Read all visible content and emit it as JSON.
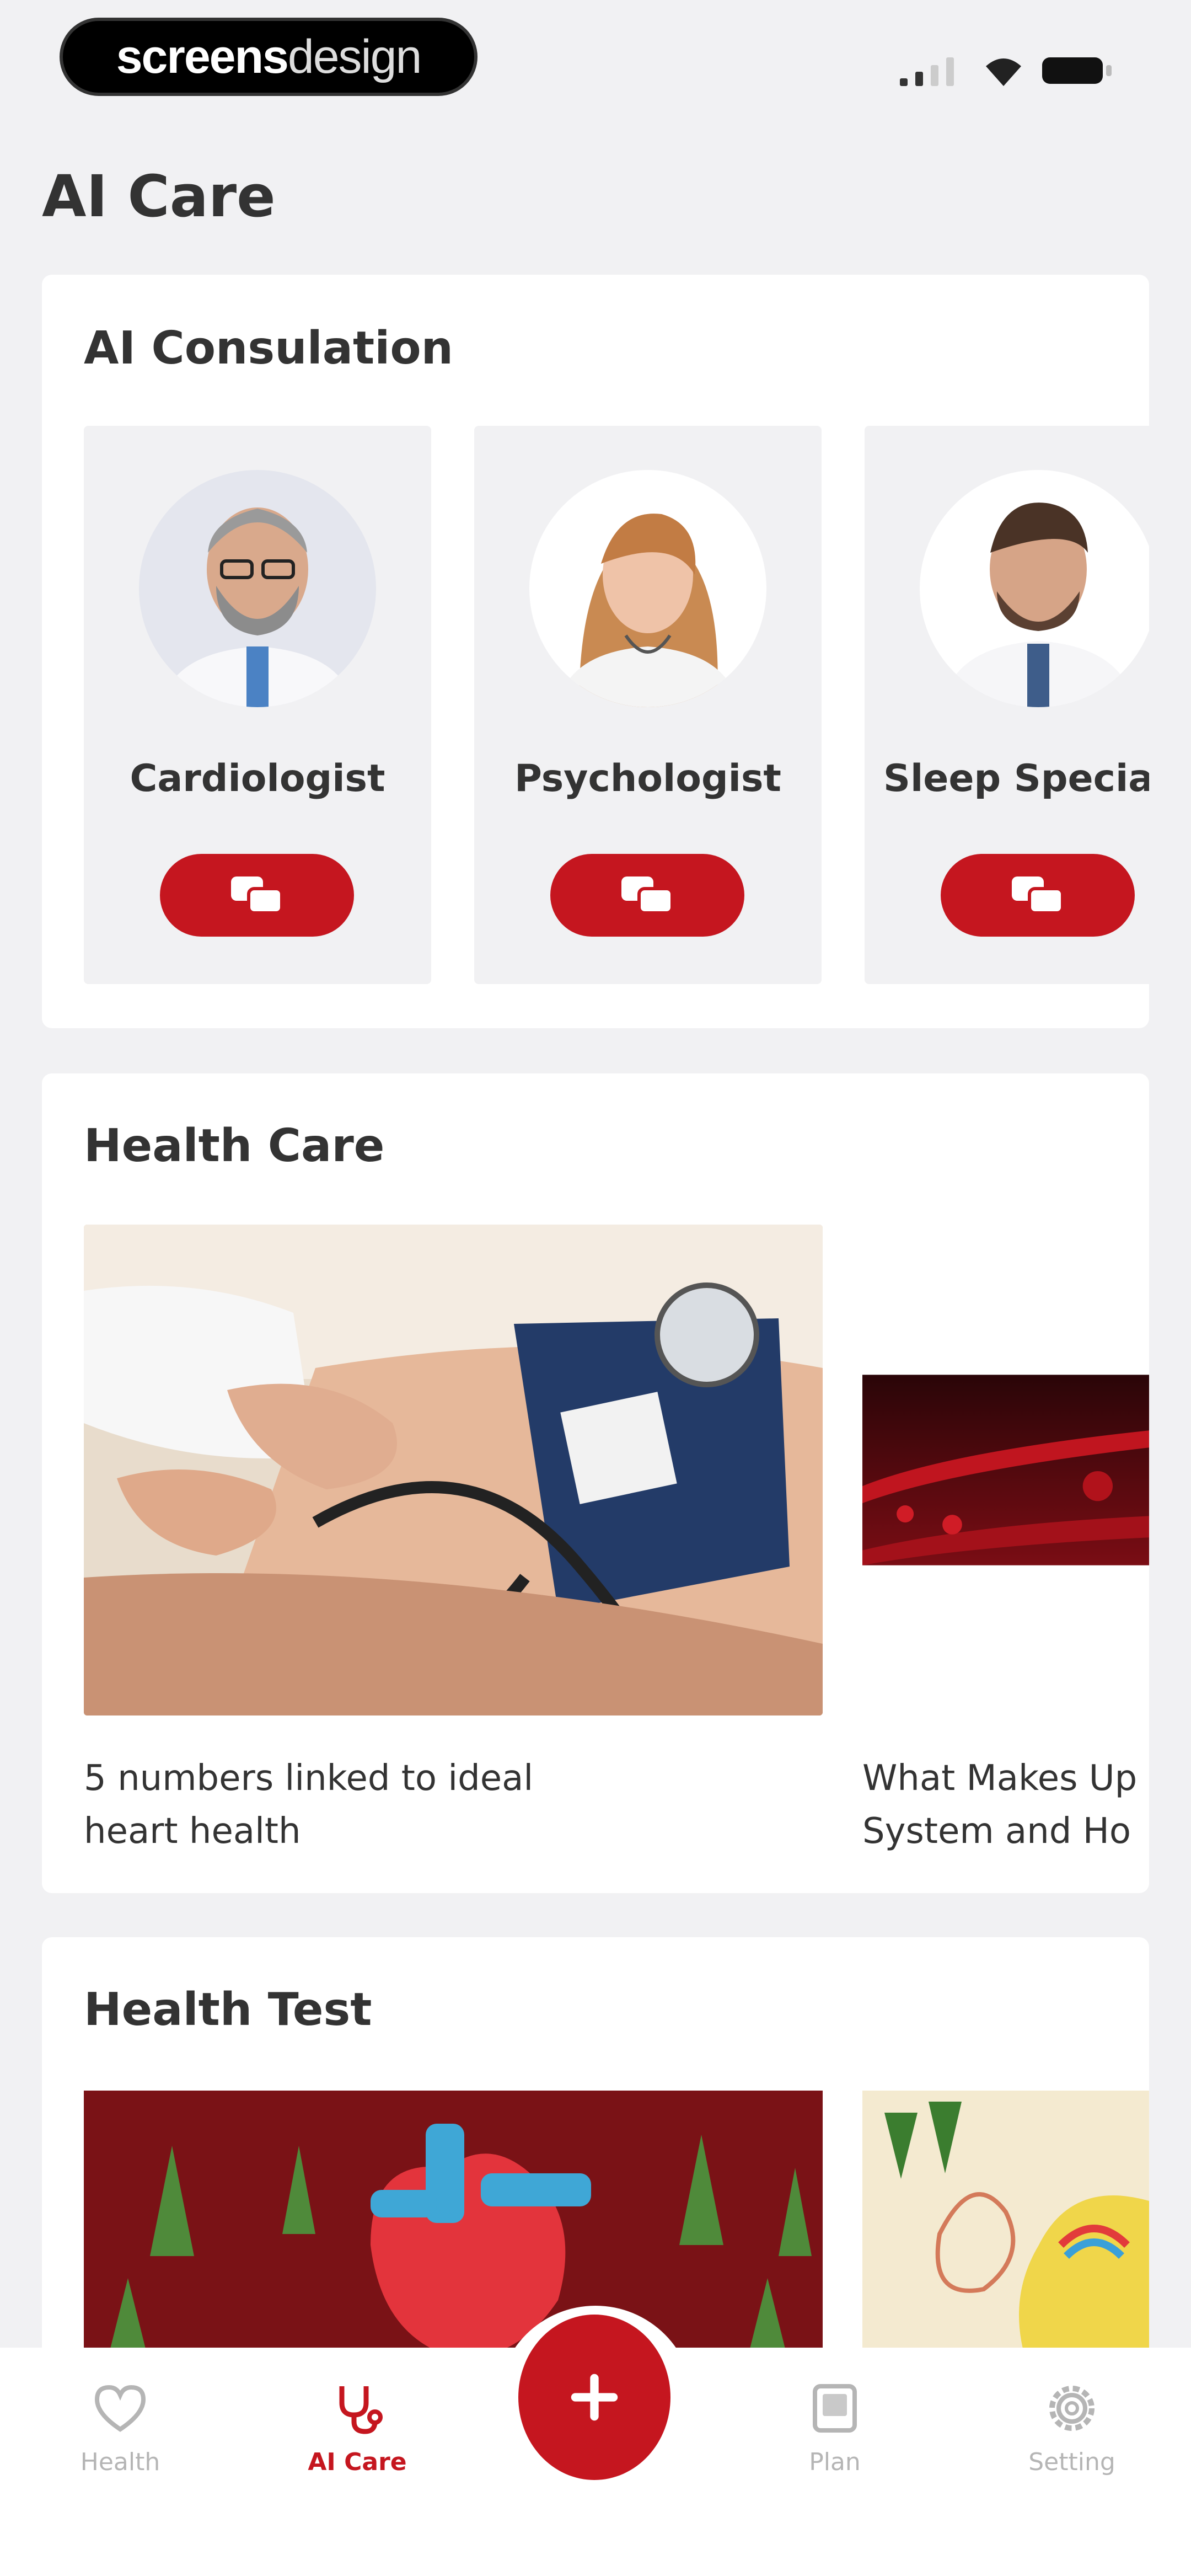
{
  "status": {
    "logo_bold": "screens",
    "logo_light": "design"
  },
  "page": {
    "title": "AI Care"
  },
  "consultation": {
    "title": "AI Consulation",
    "doctors": [
      {
        "name": "Cardiologist",
        "icon": "chat-icon"
      },
      {
        "name": "Psychologist",
        "icon": "chat-icon"
      },
      {
        "name": "Sleep Special",
        "icon": "chat-icon"
      }
    ]
  },
  "health_care": {
    "title": "Health Care",
    "articles": [
      {
        "caption_line1": "5 numbers linked to ideal",
        "caption_line2": "heart health"
      },
      {
        "caption_line1": "What Makes Up",
        "caption_line2": "System and Ho"
      }
    ]
  },
  "health_test": {
    "title": "Health Test"
  },
  "tabs": [
    {
      "label": "Health",
      "icon": "heart-icon",
      "active": false
    },
    {
      "label": "AI Care",
      "icon": "stethoscope-icon",
      "active": true
    },
    {
      "label": "Plan",
      "icon": "plan-icon",
      "active": false
    },
    {
      "label": "Setting",
      "icon": "gear-icon",
      "active": false
    }
  ],
  "colors": {
    "accent": "#c5161f",
    "background": "#f1f1f3",
    "card": "#ffffff"
  }
}
